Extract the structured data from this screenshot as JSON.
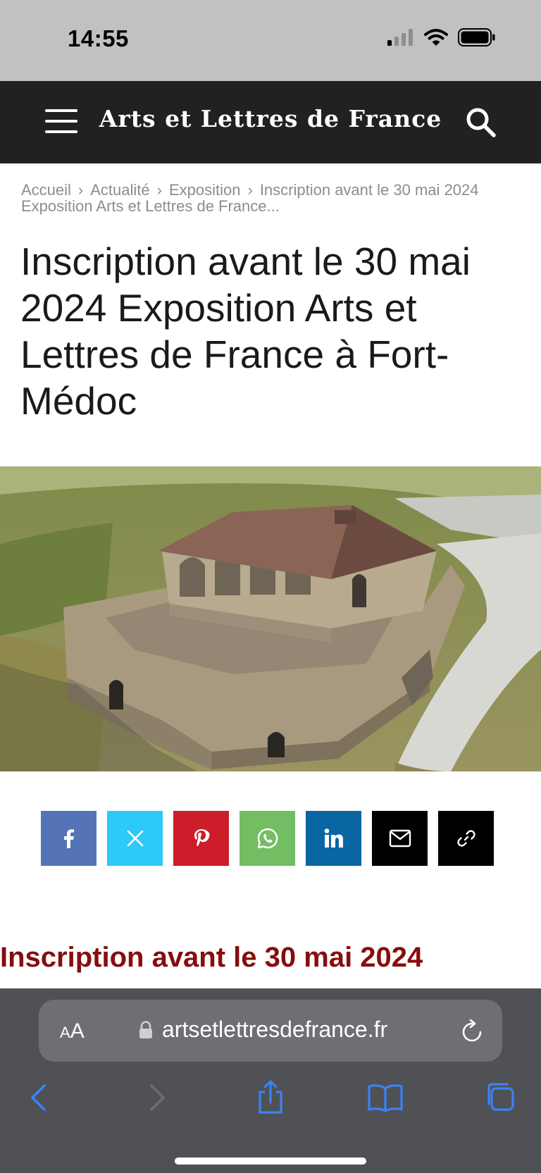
{
  "status_bar": {
    "time": "14:55",
    "icons": [
      "cellular-signal-icon",
      "wifi-icon",
      "battery-icon"
    ]
  },
  "header": {
    "logo_text": "Arts et Lettres de France",
    "menu_icon": "hamburger-menu-icon",
    "search_icon": "search-icon",
    "background": "#212121"
  },
  "breadcrumb": {
    "items": [
      "Accueil",
      "Actualité",
      "Exposition"
    ],
    "separator": "›",
    "current": "Inscription avant le 30 mai 2024 Exposition Arts et Lettres de France..."
  },
  "article": {
    "title": "Inscription avant le 30 mai 2024 Exposition Arts et Lettres de France à Fort-Médoc",
    "section_heading": "Inscription avant le 30 mai 2024",
    "heading_color": "#870d0d"
  },
  "share": {
    "buttons": [
      {
        "name": "facebook",
        "icon": "facebook-icon",
        "color": "#5573b7"
      },
      {
        "name": "x",
        "icon": "x-icon",
        "color": "#2dc9f7"
      },
      {
        "name": "pinterest",
        "icon": "pinterest-icon",
        "color": "#cd1c2a"
      },
      {
        "name": "whatsapp",
        "icon": "whatsapp-icon",
        "color": "#73bd63"
      },
      {
        "name": "linkedin",
        "icon": "linkedin-icon",
        "color": "#0a66a3"
      },
      {
        "name": "email",
        "icon": "mail-icon",
        "color": "#000000"
      },
      {
        "name": "copy-link",
        "icon": "link-icon",
        "color": "#000000"
      }
    ]
  },
  "safari": {
    "aa_small": "A",
    "aa_large": "A",
    "url": "artsetlettresdefrance.fr",
    "accent": "#3b82f6"
  }
}
